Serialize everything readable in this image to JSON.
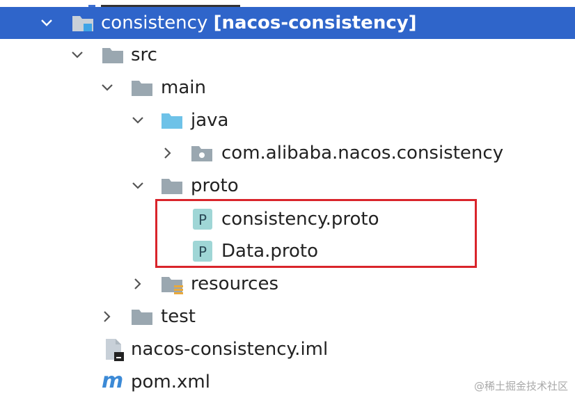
{
  "tree": {
    "root": {
      "label": "consistency",
      "module": "[nacos-consistency]"
    },
    "src": {
      "label": "src"
    },
    "main": {
      "label": "main"
    },
    "java": {
      "label": "java"
    },
    "package": {
      "label": "com.alibaba.nacos.consistency"
    },
    "proto": {
      "label": "proto"
    },
    "proto_files": [
      {
        "label": "consistency.proto",
        "icon": "P"
      },
      {
        "label": "Data.proto",
        "icon": "P"
      }
    ],
    "resources": {
      "label": "resources"
    },
    "test": {
      "label": "test"
    },
    "iml": {
      "label": "nacos-consistency.iml"
    },
    "pom": {
      "label": "pom.xml",
      "icon": "m"
    }
  },
  "colors": {
    "selection": "#2f65ca",
    "folder": "#9aa7b0",
    "source_folder": "#6ec2e8",
    "proto_icon": "#9fd6d6",
    "highlight": "#d9242b"
  },
  "watermark": "@稀土掘金技术社区"
}
